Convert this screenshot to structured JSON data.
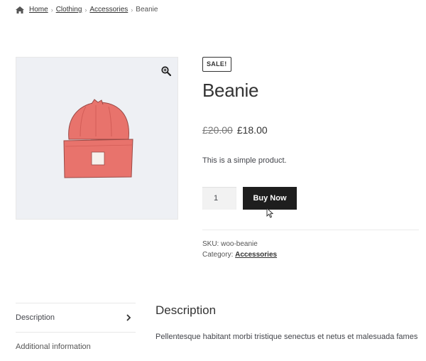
{
  "breadcrumb": {
    "home": "Home",
    "clothing": "Clothing",
    "accessories": "Accessories",
    "current": "Beanie",
    "separator": "›"
  },
  "product": {
    "sale_badge": "SALE!",
    "title": "Beanie",
    "old_price": "£20.00",
    "price": "£18.00",
    "short_description": "This is a simple product.",
    "quantity": "1",
    "buy_label": "Buy Now",
    "sku_label": "SKU:",
    "sku_value": "woo-beanie",
    "category_label": "Category:",
    "category_value": "Accessories",
    "image_icon": "beanie-hat-icon"
  },
  "tabs": {
    "description": "Description",
    "additional": "Additional information"
  },
  "description": {
    "heading": "Description",
    "text": "Pellentesque habitant morbi tristique senectus et netus et malesuada fames"
  },
  "colors": {
    "button": "#1e1e1e",
    "gallery_bg": "#eef0f4",
    "hat": "#e8736c"
  }
}
